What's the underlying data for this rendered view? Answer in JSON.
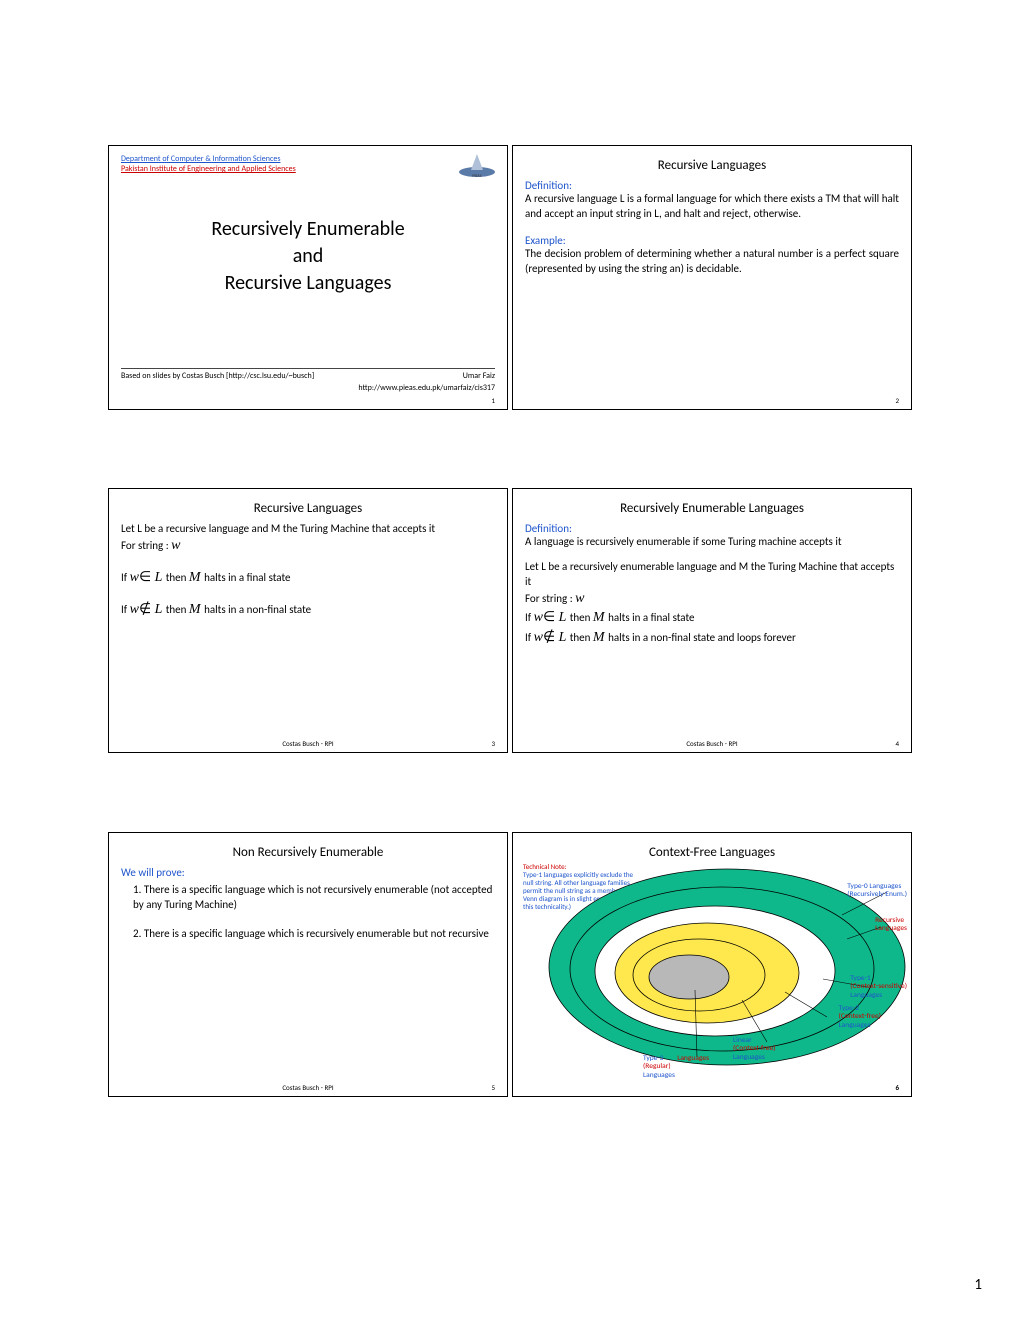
{
  "page_number": "1",
  "slides": [
    {
      "num": "1",
      "dept": "Department of Computer & Information Sciences",
      "inst": "Pakistan Institute of Engineering and Applied Sciences",
      "title_l1": "Recursively Enumerable",
      "title_l2": "and",
      "title_l3": "Recursive Languages",
      "based_on": "Based on slides by Costas Busch [http://csc.lsu.edu/~busch]",
      "author": "Umar Faiz",
      "url": "http://www.pieas.edu.pk/umarfaiz/cis317"
    },
    {
      "num": "2",
      "title": "Recursive Languages",
      "def_label": "Definition:",
      "def_text": "A recursive language L is a formal language for which there exists a TM that will halt and accept an input string in L, and halt and reject, otherwise.",
      "ex_label": "Example:",
      "ex_text": "The decision problem of determining whether a natural number is a perfect square (represented by using the string an) is decidable."
    },
    {
      "num": "3",
      "title": "Recursive Languages",
      "line1": "Let  L be a recursive language and M the Turing Machine that accepts it",
      "line2a": "For string : ",
      "line2b": "w",
      "if1a": "If  ",
      "if1b": "w",
      "if1c": "∈",
      "if1d": " L ",
      "if1e": " then ",
      "if1f": "M ",
      "if1g": " halts in a final state",
      "if2a": "If  ",
      "if2b": "w",
      "if2c": "∉",
      "if2d": " L ",
      "if2e": " then ",
      "if2f": "M ",
      "if2g": " halts in a non-final state",
      "credit": "Costas Busch - RPI"
    },
    {
      "num": "4",
      "title": "Recursively Enumerable Languages",
      "def_label": "Definition:",
      "def_text": "A language is recursively enumerable if some Turing machine accepts it",
      "line1": "Let  L be a recursively enumerable language and M the Turing Machine that accepts it",
      "line2a": "For string : ",
      "line2b": "w",
      "if1a": "If  ",
      "if1b": "w",
      "if1c": "∈",
      "if1d": " L ",
      "if1e": " then ",
      "if1f": "M ",
      "if1g": " halts in a final state",
      "if2a": "If  ",
      "if2b": "w",
      "if2c": "∉",
      "if2d": " L ",
      "if2e": " then ",
      "if2f": "M ",
      "if2g": " halts in a non-final state and loops forever",
      "credit": "Costas Busch - RPI"
    },
    {
      "num": "5",
      "title": "Non Recursively Enumerable",
      "prove_label": "We will prove:",
      "item1": "1. There is a specific language which is not recursively enumerable (not accepted by any Turing Machine)",
      "item2": "2. There is a specific language which is recursively enumerable but not recursive",
      "credit": "Costas Busch - RPI"
    },
    {
      "num": "6",
      "title": "Context-Free Languages",
      "tech_note_hd": "Technical Note:",
      "tech_note": "Type-1 languages explicitly exclude the null string. All other language families permit the null string as a member. (The Venn diagram is in slight error because of this technicality.)",
      "labels": {
        "type0a": "Type-0 Languages",
        "type0b": "(Recursively Enum.)",
        "rec": "Recursive",
        "rec2": "Languages",
        "type1a": "Type-1",
        "type1b": "(Context-sensitive)",
        "type1c": "Languages",
        "type2a": "Type-2",
        "type2b": "(Context-free)",
        "type2c": "Languages",
        "linear1": "Linear",
        "linear2": "(Context-free)",
        "linear3": "Languages",
        "type3a": "Type-3",
        "type3b": "(Regular)",
        "type3c": "Languages"
      }
    }
  ]
}
